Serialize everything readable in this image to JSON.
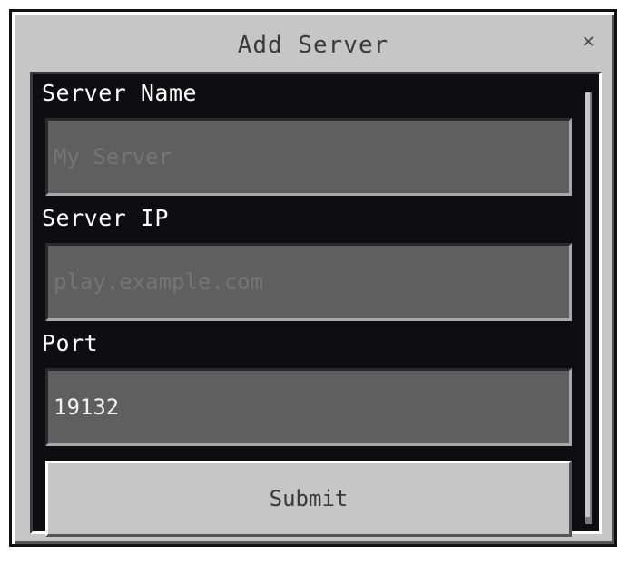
{
  "dialog": {
    "title": "Add Server",
    "close_glyph": "✕",
    "close_icon": "close-icon"
  },
  "form": {
    "server_name": {
      "label": "Server Name",
      "placeholder": "My Server",
      "value": ""
    },
    "server_ip": {
      "label": "Server IP",
      "placeholder": "play.example.com",
      "value": ""
    },
    "port": {
      "label": "Port",
      "placeholder": "",
      "value": "19132"
    },
    "submit_label": "Submit"
  },
  "colors": {
    "dialog_bg": "#c6c6c6",
    "content_bg": "#0e0e10",
    "input_bg": "#5f5f5f",
    "label_text": "#ffffff"
  }
}
